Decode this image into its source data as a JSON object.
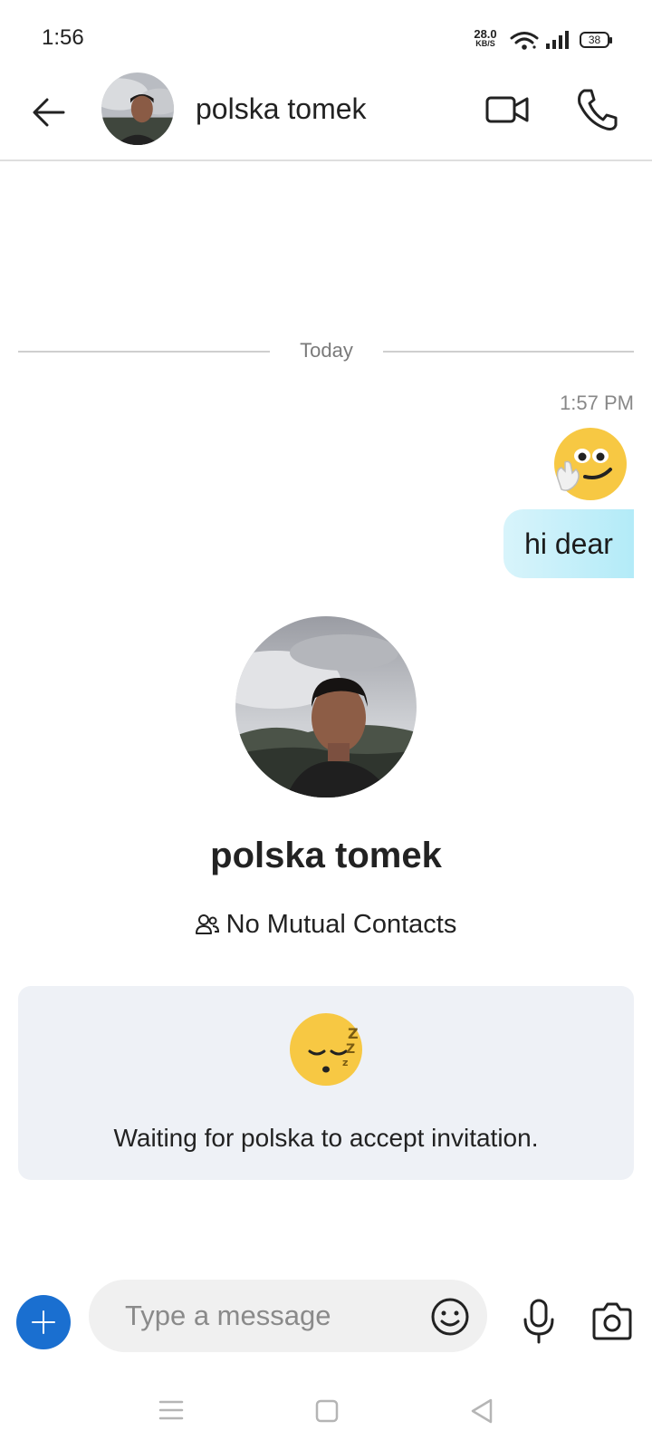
{
  "status_bar": {
    "time": "1:56",
    "net_speed_value": "28.0",
    "net_speed_unit": "KB/S",
    "battery": "38"
  },
  "header": {
    "contact_name": "polska tomek",
    "icons": [
      "back-arrow-icon",
      "video-call-icon",
      "phone-call-icon"
    ]
  },
  "chat": {
    "date_divider": "Today",
    "message": {
      "time": "1:57 PM",
      "emoji": "waving-face-emoji",
      "text": "hi dear"
    }
  },
  "profile": {
    "name": "polska tomek",
    "mutual_contacts": "No Mutual Contacts",
    "invite_status": "Waiting for polska to accept invitation.",
    "invite_emoji": "sleeping-face-emoji"
  },
  "composer": {
    "placeholder": "Type a message",
    "value": "",
    "icons": [
      "plus-icon",
      "emoji-icon",
      "microphone-icon",
      "camera-icon"
    ]
  },
  "colors": {
    "accent": "#1a6fd0",
    "bubble_start": "#d8f4fb",
    "bubble_end": "#b3ebf8",
    "card_bg": "#eef1f6",
    "emoji_yellow": "#f7c843"
  }
}
